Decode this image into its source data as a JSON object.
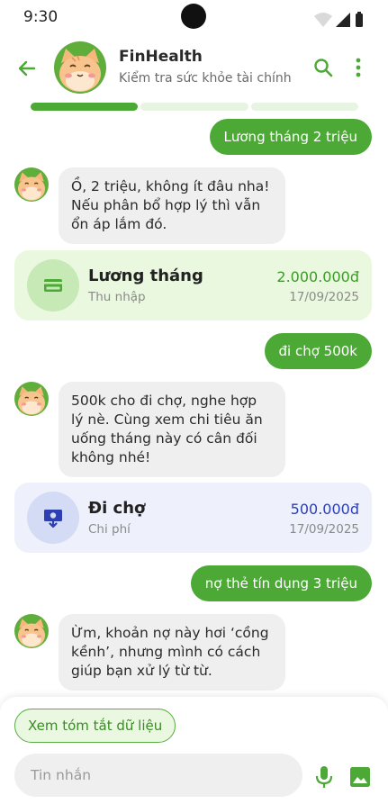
{
  "status_bar": {
    "time": "9:30"
  },
  "header": {
    "title": "FinHealth",
    "subtitle": "Kiểm tra sức khỏe tài chính",
    "progress_filled_segments": 1,
    "progress_total_segments": 3
  },
  "messages": [
    {
      "from": "user",
      "text": "Lương tháng 2 triệu"
    },
    {
      "from": "bot",
      "text": "Ồ, 2 triệu, không ít đâu nha! Nếu phân bổ hợp lý thì vẫn ổn áp lắm đó."
    },
    {
      "from": "card",
      "kind": "income",
      "icon": "credit-card-icon",
      "title": "Lương tháng",
      "category": "Thu nhập",
      "amount": "2.000.000đ",
      "date": "17/09/2025"
    },
    {
      "from": "user",
      "text": "đi chợ 500k"
    },
    {
      "from": "bot",
      "text": "500k cho đi chợ, nghe hợp lý nè. Cùng xem chi tiêu ăn uống tháng này có cân đối không nhé!"
    },
    {
      "from": "card",
      "kind": "expense",
      "icon": "cash-download-icon",
      "title": "Đi chợ",
      "category": "Chi phí",
      "amount": "500.000đ",
      "date": "17/09/2025"
    },
    {
      "from": "user",
      "text": "nợ thẻ tín dụng 3 triệu"
    },
    {
      "from": "bot",
      "text": "Ừm, khoản nợ này hơi ‘cồng kềnh’, nhưng mình có cách giúp bạn xử lý từ từ."
    }
  ],
  "bottom": {
    "summary_chip": "Xem tóm tắt dữ liệu",
    "input_placeholder": "Tin nhắn"
  },
  "colors": {
    "accent": "#4ca936",
    "income_amount": "#3d9a2a",
    "expense_amount": "#2d3fb1"
  }
}
